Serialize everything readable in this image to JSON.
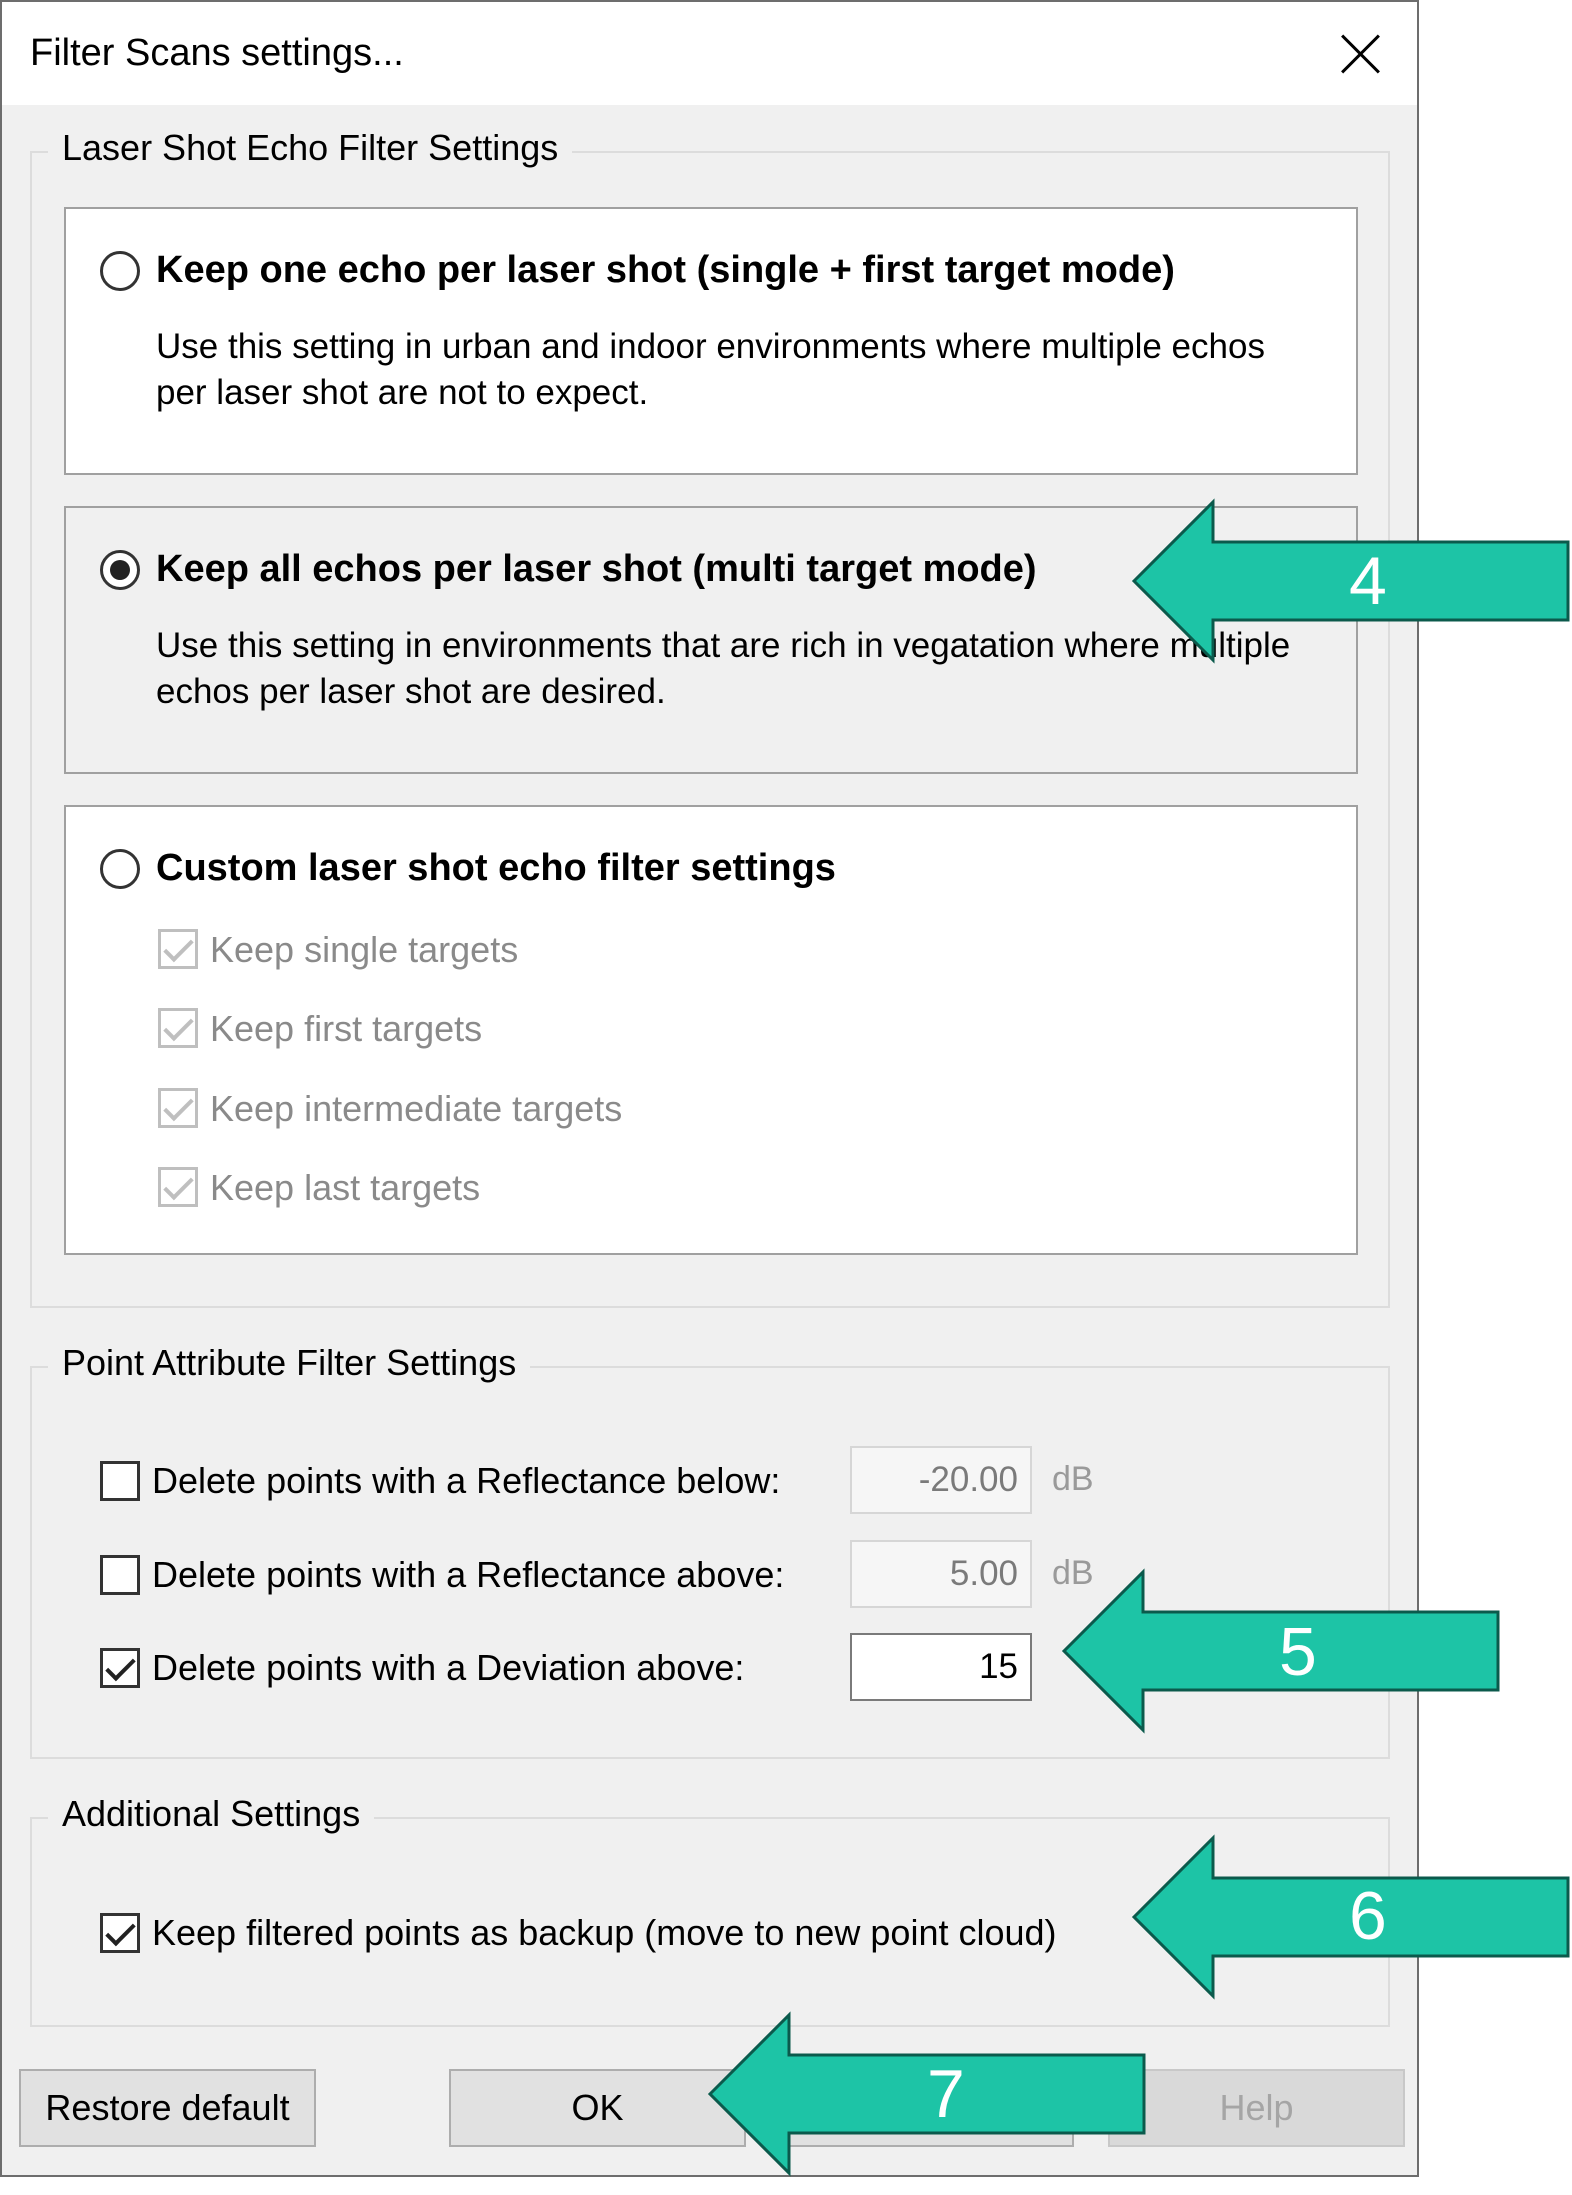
{
  "window": {
    "title": "Filter Scans settings..."
  },
  "laser_group": {
    "legend": "Laser Shot Echo Filter Settings",
    "options": [
      {
        "title": "Keep one echo per laser shot (single + first target mode)",
        "desc": "Use this setting in urban and indoor environments where multiple echos per laser shot are not to expect.",
        "selected": false
      },
      {
        "title": "Keep all echos per laser shot (multi target mode)",
        "desc": "Use this setting in environments that are rich in vegatation where multiple echos per laser shot are desired.",
        "selected": true
      },
      {
        "title": "Custom laser shot echo filter settings",
        "selected": false
      }
    ],
    "custom_checks": [
      {
        "label": "Keep single targets",
        "checked": true
      },
      {
        "label": "Keep first targets",
        "checked": true
      },
      {
        "label": "Keep intermediate targets",
        "checked": true
      },
      {
        "label": "Keep last targets",
        "checked": true
      }
    ]
  },
  "point_group": {
    "legend": "Point Attribute Filter Settings",
    "rows": [
      {
        "label": "Delete points with a Reflectance below:",
        "checked": false,
        "value": "-20.00",
        "unit": "dB"
      },
      {
        "label": "Delete points with a Reflectance above:",
        "checked": false,
        "value": "5.00",
        "unit": "dB"
      },
      {
        "label": "Delete points with a Deviation above:",
        "checked": true,
        "value": "15"
      }
    ]
  },
  "additional_group": {
    "legend": "Additional Settings",
    "backup_label": "Keep filtered points as backup (move to new point cloud)",
    "backup_checked": true
  },
  "buttons": {
    "restore": "Restore default",
    "ok": "OK",
    "help": "Help"
  },
  "annotations": {
    "color": "#1dc4a6",
    "arrows": [
      "4",
      "5",
      "6",
      "7"
    ]
  }
}
